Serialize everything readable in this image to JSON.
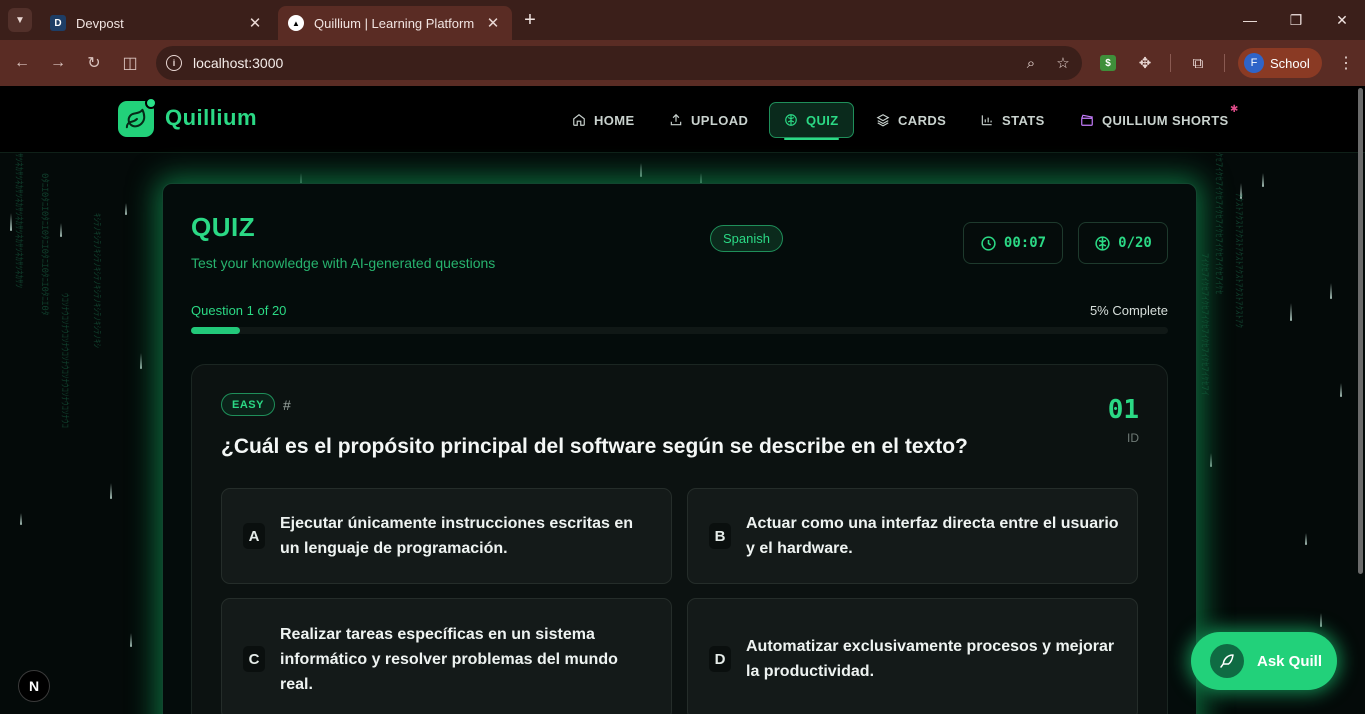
{
  "browser": {
    "tabs": [
      {
        "title": "Devpost",
        "favicon": "D"
      },
      {
        "title": "Quillium | Learning Platform"
      }
    ],
    "url": "localhost:3000",
    "profile": {
      "initial": "F",
      "name": "School"
    },
    "theme_color": "#5a2c24"
  },
  "app": {
    "logo_text": "Quillium",
    "nav": [
      {
        "label": "HOME",
        "icon": "home-icon"
      },
      {
        "label": "UPLOAD",
        "icon": "upload-icon"
      },
      {
        "label": "QUIZ",
        "icon": "brain-icon",
        "active": true
      },
      {
        "label": "CARDS",
        "icon": "layers-icon"
      },
      {
        "label": "STATS",
        "icon": "bar-chart-icon"
      },
      {
        "label": "QUILLIUM SHORTS",
        "icon": "clapperboard-icon"
      }
    ],
    "accent_color": "#2bd985"
  },
  "quiz": {
    "title": "QUIZ",
    "subtitle": "Test your knowledge with AI-generated questions",
    "language": "Spanish",
    "timer": "00:07",
    "score": "0/20",
    "progress_label": "Question 1 of 20",
    "progress_pct_label": "5% Complete",
    "progress_fraction": 0.05,
    "question": {
      "difficulty": "EASY",
      "hash": "#",
      "number": "01",
      "id_label": "ID",
      "text": "¿Cuál es el propósito principal del software según se describe en el texto?",
      "options": [
        {
          "letter": "A",
          "text": "Ejecutar únicamente instrucciones escritas en un lenguaje de programación."
        },
        {
          "letter": "B",
          "text": "Actuar como una interfaz directa entre el usuario y el hardware."
        },
        {
          "letter": "C",
          "text": "Realizar tareas específicas en un sistema informático y resolver problemas del mundo real."
        },
        {
          "letter": "D",
          "text": "Automatizar exclusivamente procesos y mejorar la productividad."
        }
      ]
    }
  },
  "assistant": {
    "label": "Ask Quill"
  },
  "dev_badge": "N"
}
